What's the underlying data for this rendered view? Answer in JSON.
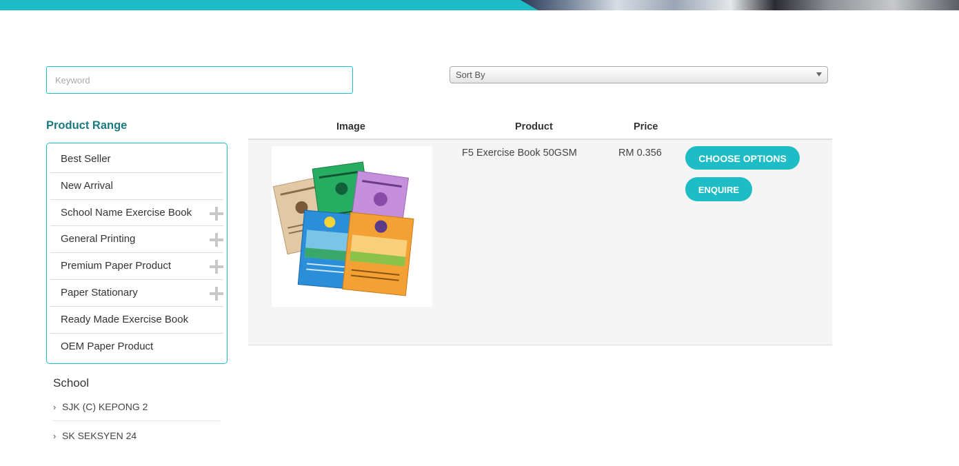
{
  "search": {
    "placeholder": "Keyword"
  },
  "sort": {
    "selected": "Sort By"
  },
  "sidebar": {
    "title": "Product Range",
    "items": [
      {
        "label": "Best Seller",
        "expandable": false
      },
      {
        "label": "New Arrival",
        "expandable": false
      },
      {
        "label": "School Name Exercise Book",
        "expandable": true
      },
      {
        "label": "General Printing",
        "expandable": true
      },
      {
        "label": "Premium Paper Product",
        "expandable": true
      },
      {
        "label": "Paper Stationary",
        "expandable": true
      },
      {
        "label": "Ready Made Exercise Book",
        "expandable": false
      },
      {
        "label": "OEM Paper Product",
        "expandable": false
      }
    ],
    "school_title": "School",
    "schools": [
      "SJK (C) KEPONG 2",
      "SK SEKSYEN 24"
    ]
  },
  "table": {
    "headers": {
      "image": "Image",
      "product": "Product",
      "price": "Price"
    },
    "rows": [
      {
        "product": "F5 Exercise Book 50GSM",
        "price": "RM 0.356",
        "choose_label": "CHOOSE OPTIONS",
        "enquire_label": "ENQUIRE"
      }
    ]
  },
  "colors": {
    "accent": "#1ebdc6",
    "title": "#1a7a80"
  }
}
